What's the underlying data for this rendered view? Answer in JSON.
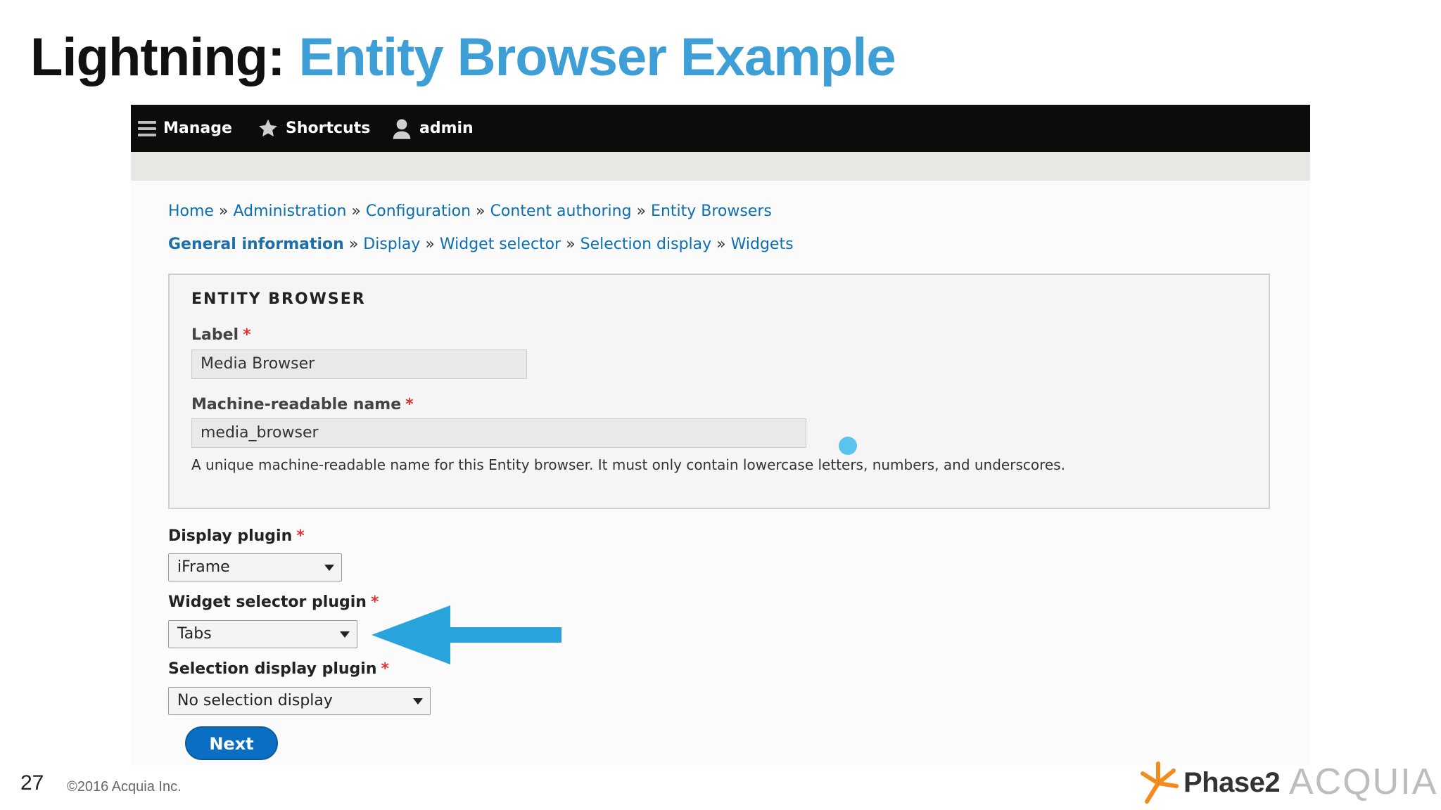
{
  "slide": {
    "title_prefix": "Lightning:",
    "title_main": "Entity Browser Example",
    "page_number": "27",
    "copyright": "©2016 Acquia Inc.",
    "logos": {
      "phase2": "Phase2",
      "acquia": "ACQUIA"
    }
  },
  "toolbar": {
    "items": [
      {
        "label": "Manage",
        "icon": "hamburger-menu-icon"
      },
      {
        "label": "Shortcuts",
        "icon": "star-icon"
      },
      {
        "label": "admin",
        "icon": "user-icon"
      }
    ]
  },
  "breadcrumb": {
    "items": [
      "Home",
      "Administration",
      "Configuration",
      "Content authoring",
      "Entity Browsers"
    ],
    "separator": "»"
  },
  "wizard_steps": {
    "items": [
      "General information",
      "Display",
      "Widget selector",
      "Selection display",
      "Widgets"
    ],
    "active": "General information",
    "separator": "»"
  },
  "entity_browser": {
    "legend": "ENTITY BROWSER",
    "label_field": {
      "label": "Label",
      "value": "Media Browser",
      "required_mark": "*"
    },
    "machine_name_field": {
      "label": "Machine-readable name",
      "value": "media_browser",
      "required_mark": "*",
      "description": "A unique machine-readable name for this Entity browser. It must only contain lowercase letters, numbers, and underscores."
    }
  },
  "plugins": {
    "display": {
      "label": "Display plugin",
      "value": "iFrame",
      "required_mark": "*"
    },
    "widget_selector": {
      "label": "Widget selector plugin",
      "value": "Tabs",
      "required_mark": "*"
    },
    "selection_display": {
      "label": "Selection display plugin",
      "value": "No selection display",
      "required_mark": "*"
    }
  },
  "actions": {
    "next_label": "Next"
  },
  "colors": {
    "title_accent": "#3d9fd6",
    "link": "#0a6fb4",
    "required": "#e03131",
    "primary_button": "#0a6fc2",
    "annotation_arrow": "#29a3dc",
    "toolbar_bg": "#0c0c0c"
  }
}
